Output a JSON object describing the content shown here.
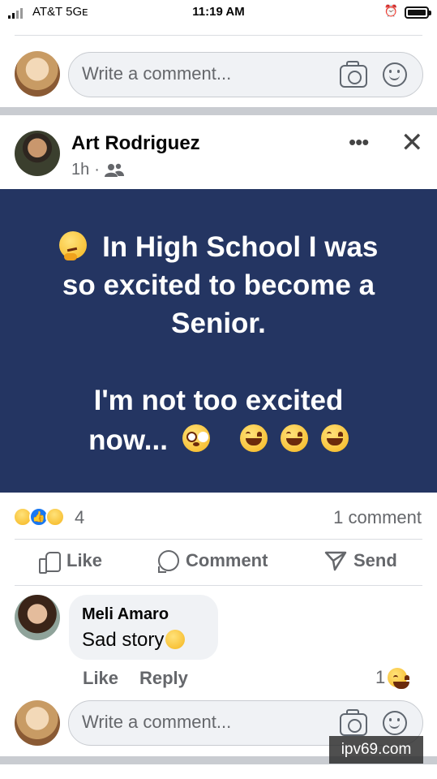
{
  "status_bar": {
    "carrier": "AT&T  5Gᴇ",
    "time": "11:19 AM"
  },
  "top_comment_box": {
    "placeholder": "Write a comment..."
  },
  "post": {
    "author": "Art Rodriguez",
    "time": "1h",
    "audience_icon": "friends-icon",
    "banner": {
      "line1": "In High School I was",
      "line2": "so excited to become a",
      "line3": "Senior.",
      "line4": "I'm not too excited",
      "line5": "now...",
      "background_color": "#243562"
    },
    "reactions": {
      "types": [
        "haha",
        "like",
        "sad"
      ],
      "count": "4"
    },
    "comment_count": "1 comment",
    "actions": {
      "like": "Like",
      "comment": "Comment",
      "send": "Send"
    }
  },
  "comments": [
    {
      "author": "Meli Amaro",
      "text": "Sad story",
      "like_label": "Like",
      "reply_label": "Reply",
      "reaction_count": "1"
    }
  ],
  "bottom_comment_box": {
    "placeholder": "Write a comment..."
  },
  "watermark": "ipv69.com"
}
